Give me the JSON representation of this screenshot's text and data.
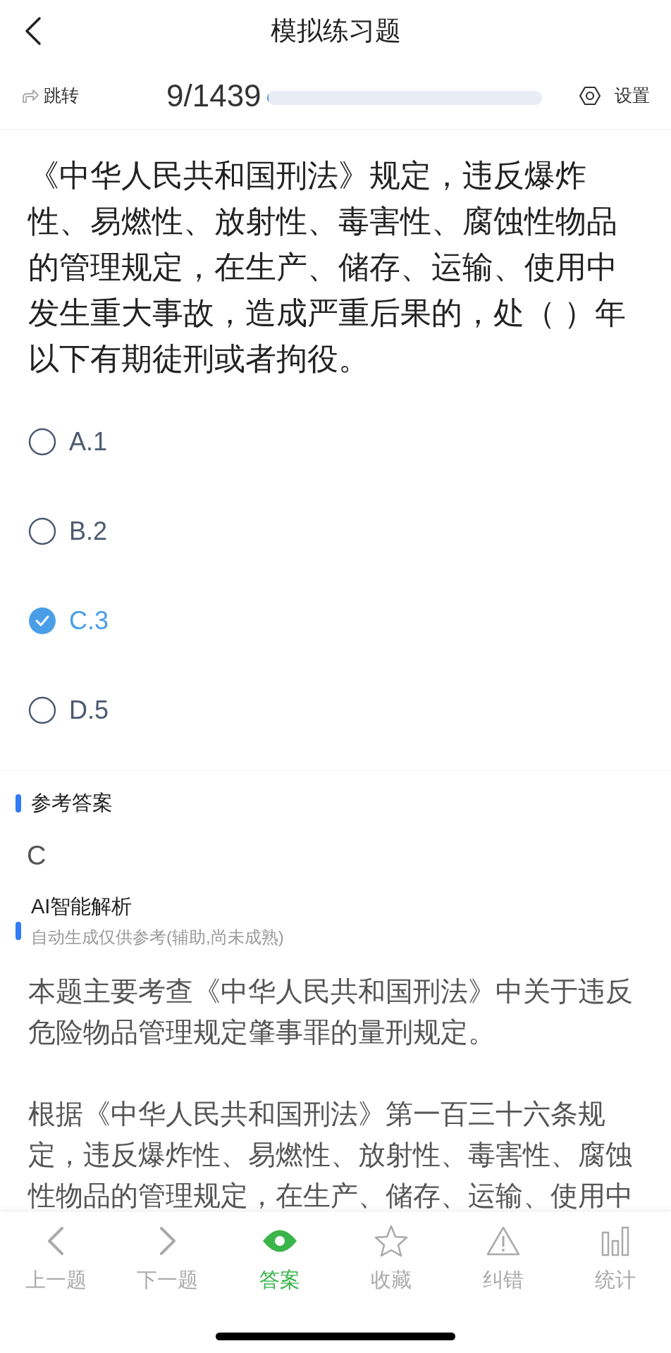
{
  "header": {
    "title": "模拟练习题"
  },
  "toolbar": {
    "jump": "跳转",
    "progress_text": "9/1439",
    "progress": {
      "level": 0.006
    },
    "settings": "设置"
  },
  "question": {
    "text": "《中华人民共和国刑法》规定，违反爆炸性、易燃性、放射性、毒害性、腐蚀性物品的管理规定，在生产、储存、运输、使用中发生重大事故，造成严重后果的，处（ ）年以下有期徒刑或者拘役。"
  },
  "options": [
    {
      "label": "A.1",
      "selected": false
    },
    {
      "label": "B.2",
      "selected": false
    },
    {
      "label": "C.3",
      "selected": true
    },
    {
      "label": "D.5",
      "selected": false
    }
  ],
  "reference": {
    "title": "参考答案",
    "answer": "C"
  },
  "analysis": {
    "title": "AI智能解析",
    "subtitle": "自动生成仅供参考(辅助,尚未成熟)",
    "paragraphs": [
      "本题主要考查《中华人民共和国刑法》中关于违反危险物品管理规定肇事罪的量刑规定。",
      "根据《中华人民共和国刑法》第一百三十六条规定，违反爆炸性、易燃性、放射性、毒害性、腐蚀性物品的管理规定，在生产、储存、运输、使用中"
    ]
  },
  "tab_bar": [
    {
      "kind": "prev",
      "label": "上一题",
      "selected": false
    },
    {
      "kind": "next",
      "label": "下一题",
      "selected": false
    },
    {
      "kind": "answer",
      "label": "答案",
      "selected": true
    },
    {
      "kind": "favorite",
      "label": "收藏",
      "selected": false
    },
    {
      "kind": "report",
      "label": "纠错",
      "selected": false
    },
    {
      "kind": "stats",
      "label": "统计",
      "selected": false
    }
  ]
}
